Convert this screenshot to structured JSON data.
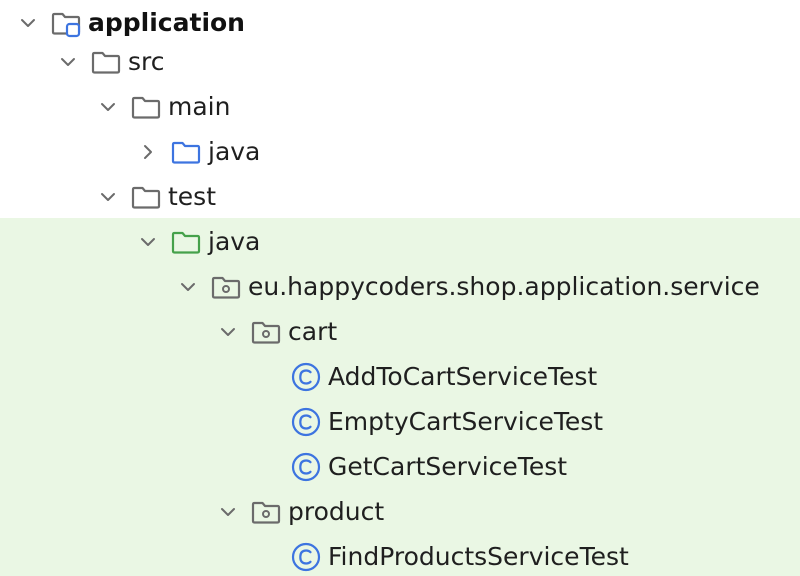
{
  "colors": {
    "test_background": "#eaf7e4",
    "folder_stroke": "#6b6b6b",
    "source_folder_stroke": "#3d74e0",
    "test_folder_stroke": "#45a14a",
    "module_badge": "#3d74e0",
    "class_icon": "#3d74e0",
    "text": "#1f1f1f"
  },
  "tree": {
    "items": [
      {
        "label": "application",
        "icon": "module-folder-icon",
        "expanded": true,
        "bold": true
      },
      {
        "label": "src",
        "icon": "folder-icon",
        "expanded": true
      },
      {
        "label": "main",
        "icon": "folder-icon",
        "expanded": true
      },
      {
        "label": "java",
        "icon": "source-root-folder-icon",
        "expanded": false
      },
      {
        "label": "test",
        "icon": "folder-icon",
        "expanded": true
      },
      {
        "label": "java",
        "icon": "test-root-folder-icon",
        "expanded": true
      },
      {
        "label": "eu.happycoders.shop.application.service",
        "icon": "package-icon",
        "expanded": true
      },
      {
        "label": "cart",
        "icon": "package-icon",
        "expanded": true
      },
      {
        "label": "AddToCartServiceTest",
        "icon": "class-icon"
      },
      {
        "label": "EmptyCartServiceTest",
        "icon": "class-icon"
      },
      {
        "label": "GetCartServiceTest",
        "icon": "class-icon"
      },
      {
        "label": "product",
        "icon": "package-icon",
        "expanded": true
      },
      {
        "label": "FindProductsServiceTest",
        "icon": "class-icon"
      }
    ]
  }
}
